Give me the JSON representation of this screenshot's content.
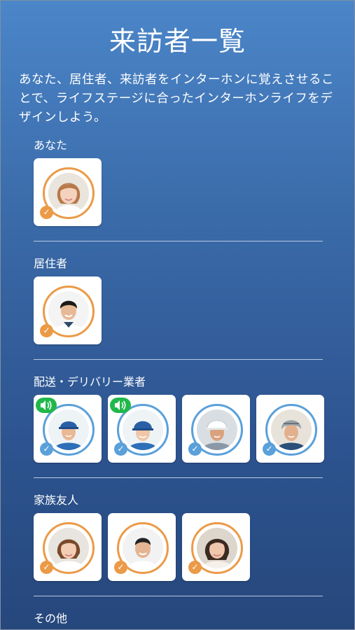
{
  "page": {
    "title": "来訪者一覧",
    "intro": "あなた、居住者、来訪者をインターホンに覚えさせることで、ライフステージに合ったインターホンライフをデザインしよう。"
  },
  "sections": [
    {
      "label": "あなた"
    },
    {
      "label": "居住者"
    },
    {
      "label": "配送・デリバリー業者"
    },
    {
      "label": "家族友人"
    },
    {
      "label": "その他"
    }
  ],
  "colors": {
    "accent_orange": "#eb9a47",
    "accent_blue": "#5aa0da",
    "speaker_green": "#21b84b"
  },
  "icons": {
    "check": "check-icon",
    "speaker": "speaker-icon"
  }
}
